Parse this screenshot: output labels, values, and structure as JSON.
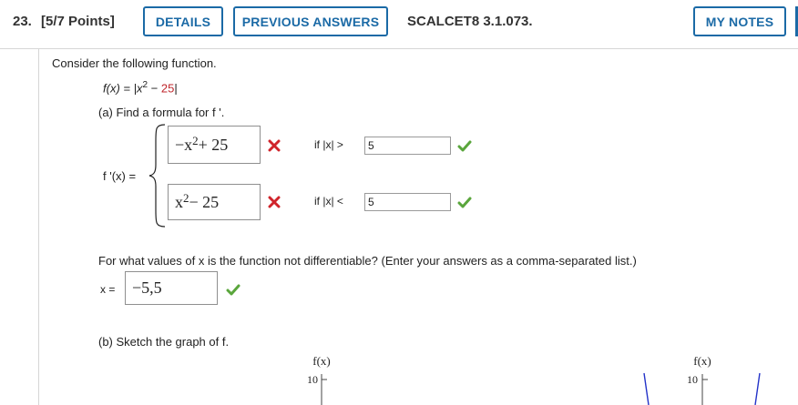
{
  "header": {
    "question_number": "23.",
    "points": "[5/7 Points]",
    "details_label": "DETAILS",
    "previous_answers_label": "PREVIOUS ANSWERS",
    "problem_code": "SCALCET8 3.1.073.",
    "my_notes_label": "MY NOTES"
  },
  "problem": {
    "intro": "Consider the following function.",
    "function_lhs": "f(x) = |x",
    "function_exp": "2",
    "function_minus": " − ",
    "function_const": "25",
    "function_close": "|",
    "part_a": "(a) Find a formula for f '.",
    "fprime_label": "f '(x) =",
    "piece1": {
      "answer_main": "−x",
      "answer_exp": "2",
      "answer_rest": " + 25",
      "condition": "if |x| >",
      "condition_value": "5",
      "answer_status": "incorrect",
      "condition_status": "correct"
    },
    "piece2": {
      "answer_main": "x",
      "answer_exp": "2",
      "answer_rest": " − 25",
      "condition": "if |x| <",
      "condition_value": "5",
      "answer_status": "incorrect",
      "condition_status": "correct"
    },
    "differentiable_question": "For what values of x is the function not differentiable? (Enter your answers as a comma-separated list.)",
    "x_label": "x =",
    "x_answer": "−5,5",
    "x_status": "correct",
    "part_b": "(b) Sketch the graph of f.",
    "graph_left": {
      "ylabel": "f(x)",
      "tick": "10"
    },
    "graph_right": {
      "ylabel": "f(x)",
      "tick": "10"
    }
  },
  "colors": {
    "accent": "#1b6aa6",
    "incorrect": "#d0242b",
    "correct": "#5aa63c",
    "function_highlight": "#c0272d",
    "graph_line": "#2433c8"
  }
}
